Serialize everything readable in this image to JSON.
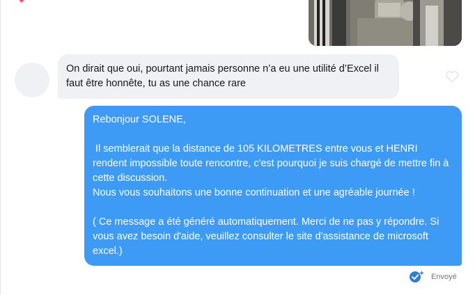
{
  "colors": {
    "accent": "#3d9bf5",
    "incoming_bubble": "#eff1f5",
    "like_pink": "#ef4d6f",
    "status_check": "#2e7dd9"
  },
  "conversation": {
    "incoming_message": {
      "text": "On dirait que oui, pourtant jamais personne n’a eu une utilité d’Excel il faut être honnête, tu as une chance rare",
      "like_icon": "heart-outline-icon"
    },
    "outgoing_message": {
      "paragraphs": [
        "Rebonjour SOLENE,",
        " Il semblerait que la distance de 105 KILOMETRES entre vous et HENRI rendent impossible toute rencontre, c'est pourquoi je suis chargé de mettre fin à cette discussion.\nNous vous souhaitons une bonne continuation et une agréable journée !",
        "( Ce message a été généré automatiquement. Merci de ne pas y répondre. Si vous avez besoin d'aide, veuillez consulter le site d'assistance de microsoft excel.)"
      ],
      "status_label": "Envoyé",
      "status_icon": "sent-check-icon"
    }
  }
}
